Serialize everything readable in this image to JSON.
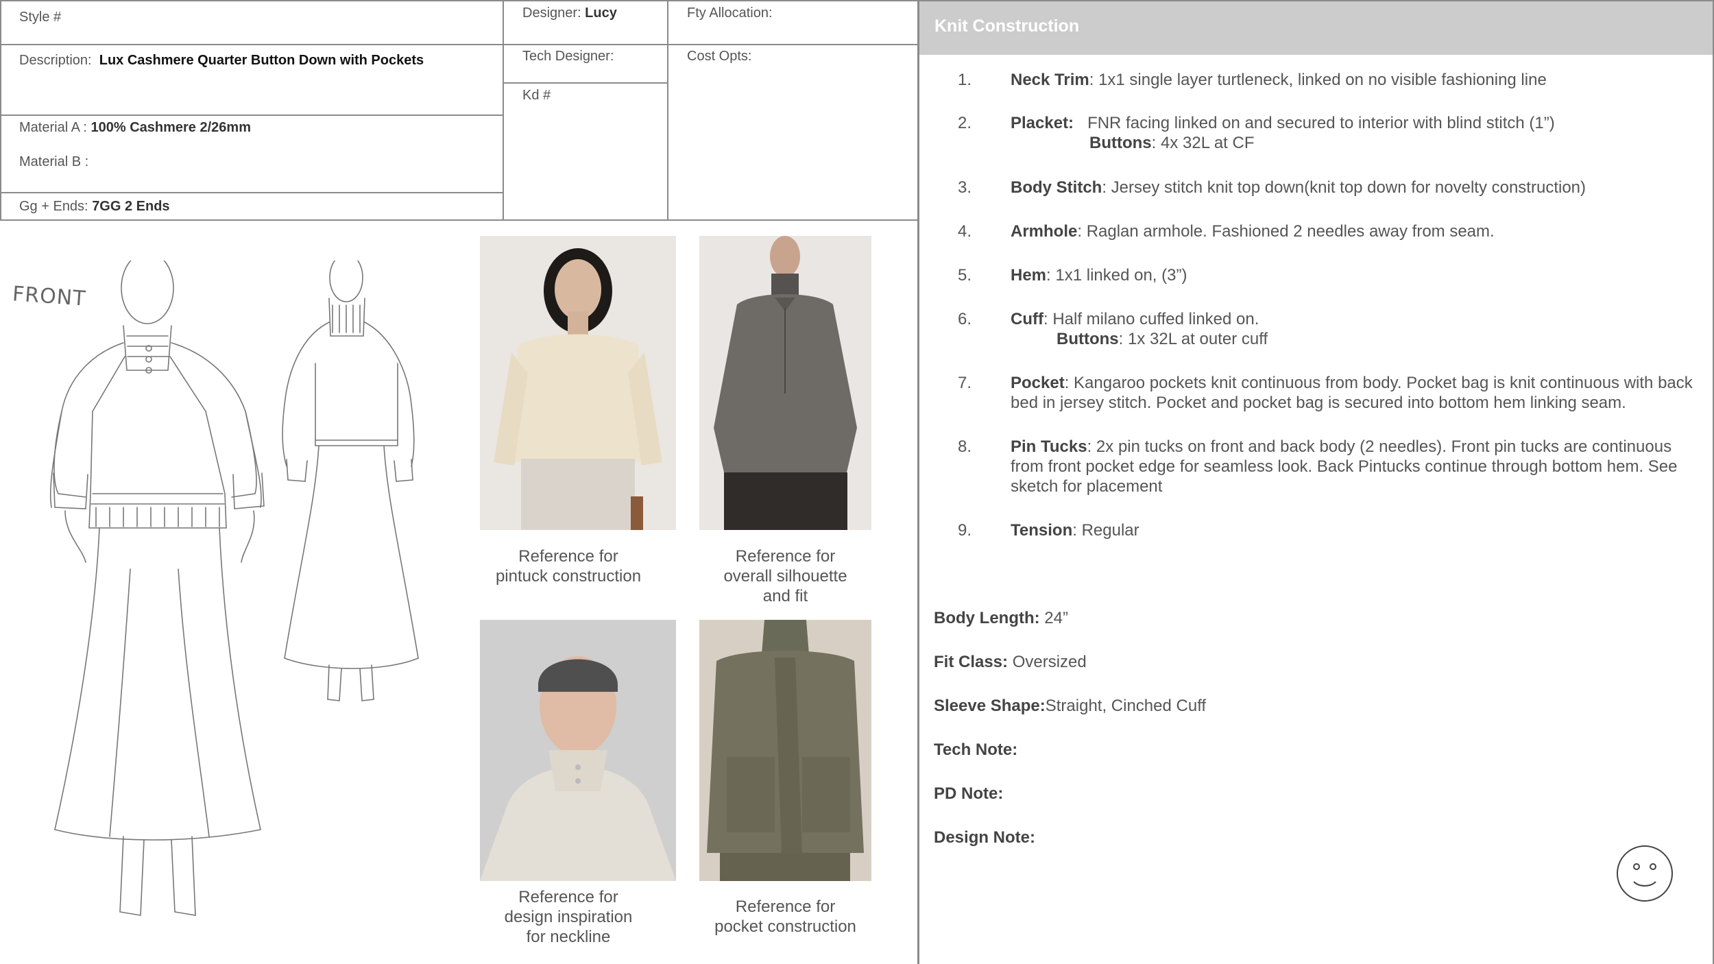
{
  "header": {
    "style_label": "Style #",
    "designer_label": "Designer:",
    "designer_value": "Lucy",
    "fty_label": "Fty Allocation:",
    "description_label": "Description:",
    "description_value": "Lux Cashmere Quarter Button Down with Pockets",
    "tech_designer_label": "Tech Designer:",
    "cost_opts_label": "Cost Opts:",
    "kd_label": "Kd #",
    "material_a_label": "Material A :",
    "material_a_value": "100% Cashmere 2/26mm",
    "material_b_label": "Material B :",
    "gg_label": "Gg + Ends:",
    "gg_value": "7GG 2 Ends"
  },
  "sketch": {
    "front_label": "FRONT"
  },
  "references": [
    {
      "caption_lines": [
        "Reference for",
        "pintuck construction"
      ]
    },
    {
      "caption_lines": [
        "Reference for",
        "overall silhouette",
        "and fit"
      ]
    },
    {
      "caption_lines": [
        "Reference for",
        "design inspiration",
        "for neckline"
      ]
    },
    {
      "caption_lines": [
        "Reference for",
        "pocket construction"
      ]
    }
  ],
  "knit_construction": {
    "title": "Knit Construction",
    "items": [
      {
        "num": "1.",
        "term": "Neck Trim",
        "text": ":  1x1 single layer turtleneck, linked on no visible fashioning line"
      },
      {
        "num": "2.",
        "term": "Placket:",
        "text": "   FNR facing linked on and secured to interior with blind stitch (1”)",
        "sub_term": "Buttons",
        "sub_text": ": 4x 32L at CF"
      },
      {
        "num": "3.",
        "term": "Body Stitch",
        "text": ": Jersey stitch knit top down(knit top down for novelty construction)"
      },
      {
        "num": "4.",
        "term": "Armhole",
        "text": ":  Raglan armhole. Fashioned 2 needles away from seam."
      },
      {
        "num": "5.",
        "term": "Hem",
        "text": ": 1x1 linked on, (3”)"
      },
      {
        "num": "6.",
        "term": "Cuff",
        "text": ":  Half milano cuffed linked on.",
        "sub_term": "Buttons",
        "sub_text": ": 1x 32L at outer cuff"
      },
      {
        "num": "7.",
        "term": "Pocket",
        "text": ": Kangaroo pockets knit continuous from body. Pocket bag is knit continuous with back bed in jersey stitch.  Pocket and pocket bag is secured into bottom hem linking seam."
      },
      {
        "num": "8.",
        "term": "Pin Tucks",
        "text": ": 2x pin tucks on front and back body (2 needles). Front pin tucks are continuous from front pocket edge for seamless look. Back Pintucks continue through bottom hem. See sketch for placement"
      },
      {
        "num": "9.",
        "term": "Tension",
        "text": ": Regular"
      }
    ]
  },
  "specs": {
    "body_length_label": "Body Length:",
    "body_length_value": " 24”",
    "fit_class_label": "Fit Class:",
    "fit_class_value": " Oversized",
    "sleeve_shape_label": "Sleeve Shape:",
    "sleeve_shape_value": "Straight, Cinched Cuff",
    "tech_note_label": "Tech Note:",
    "pd_note_label": "PD Note:",
    "design_note_label": "Design Note:"
  }
}
